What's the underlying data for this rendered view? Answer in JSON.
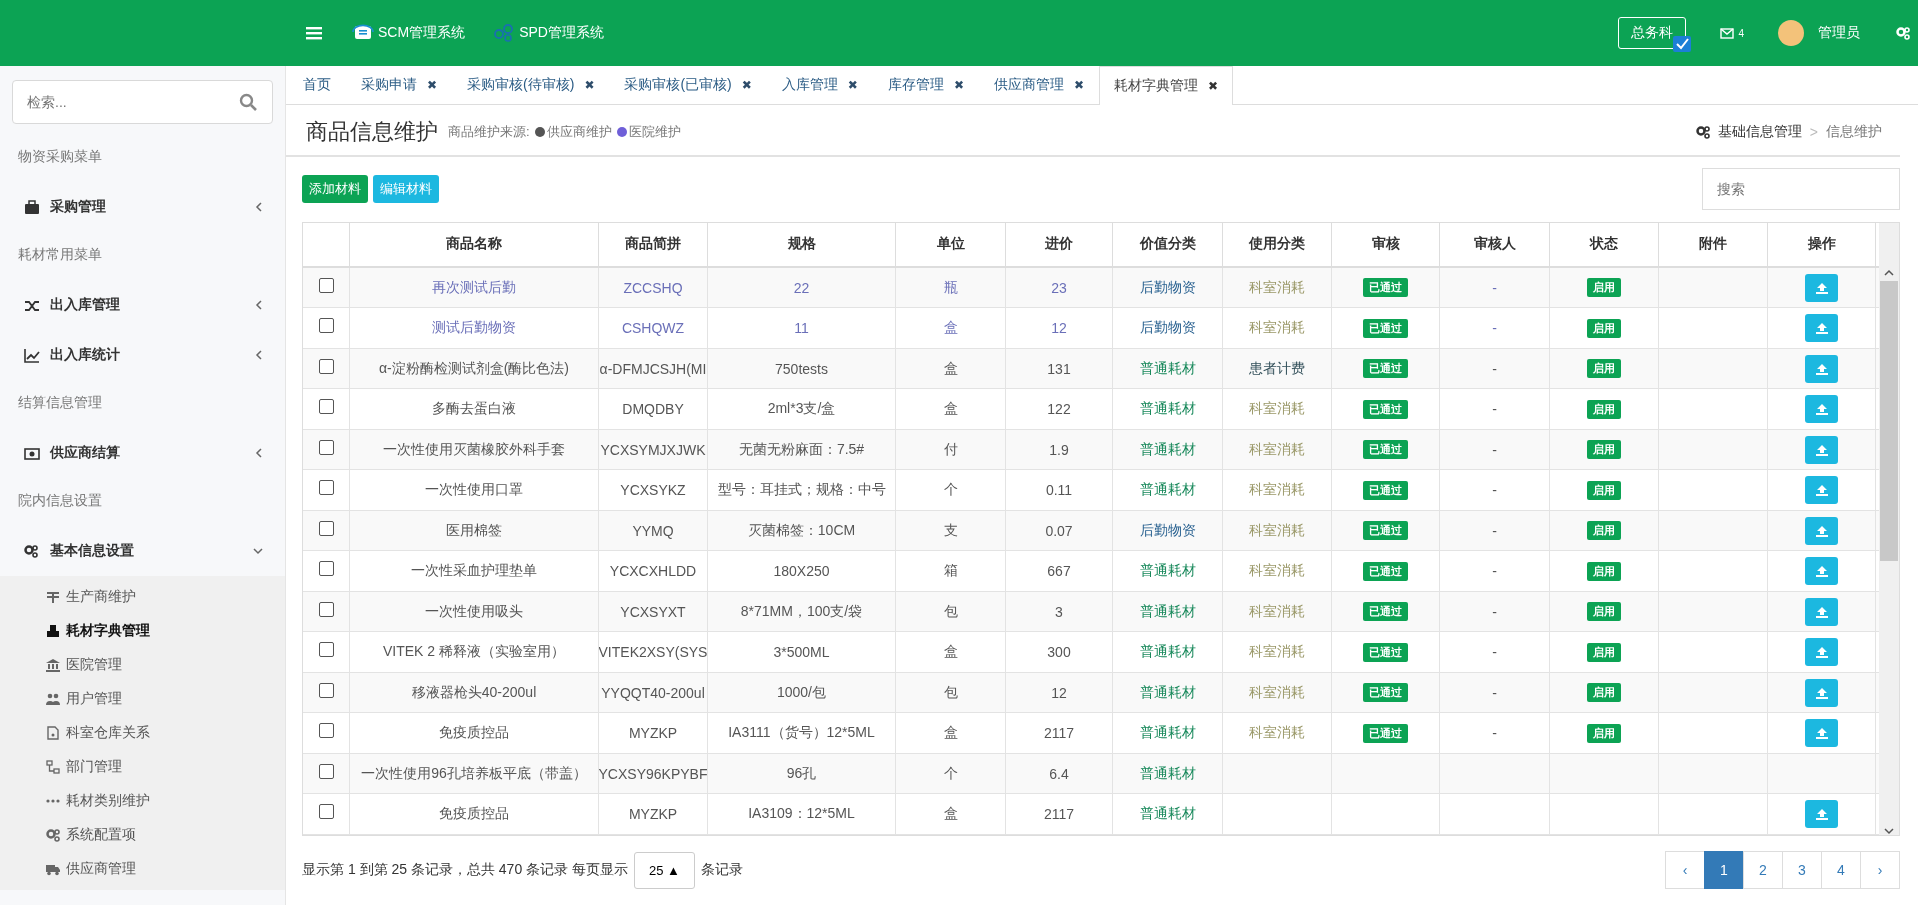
{
  "header": {
    "systems": [
      "SCM管理系统",
      "SPD管理系统"
    ],
    "department": "总务科",
    "mail_count": "4",
    "user": "管理员"
  },
  "sidebar": {
    "search": {
      "placeholder": "检索..."
    },
    "sections": [
      {
        "heading": "物资采购菜单",
        "items": [
          {
            "label": "采购管理",
            "expanded": false
          }
        ]
      },
      {
        "heading": "耗材常用菜单",
        "items": [
          {
            "label": "出入库管理",
            "expanded": false
          },
          {
            "label": "出入库统计",
            "expanded": false
          }
        ]
      },
      {
        "heading": "结算信息管理",
        "items": [
          {
            "label": "供应商结算",
            "expanded": false
          }
        ]
      },
      {
        "heading": "院内信息设置",
        "items": [
          {
            "label": "基本信息设置",
            "expanded": true,
            "children": [
              {
                "label": "生产商维护",
                "selected": false
              },
              {
                "label": "耗材字典管理",
                "selected": true
              },
              {
                "label": "医院管理",
                "selected": false
              },
              {
                "label": "用户管理",
                "selected": false
              },
              {
                "label": "科室仓库关系",
                "selected": false
              },
              {
                "label": "部门管理",
                "selected": false
              },
              {
                "label": "耗材类别维护",
                "selected": false
              },
              {
                "label": "系统配置项",
                "selected": false
              },
              {
                "label": "供应商管理",
                "selected": false
              }
            ]
          }
        ]
      }
    ]
  },
  "tabs": [
    {
      "label": "首页",
      "closable": false,
      "selected": false
    },
    {
      "label": "采购申请",
      "closable": true,
      "selected": false
    },
    {
      "label": "采购审核(待审核)",
      "closable": true,
      "selected": false
    },
    {
      "label": "采购审核(已审核)",
      "closable": true,
      "selected": false
    },
    {
      "label": "入库管理",
      "closable": true,
      "selected": false
    },
    {
      "label": "库存管理",
      "closable": true,
      "selected": false
    },
    {
      "label": "供应商管理",
      "closable": true,
      "selected": false
    },
    {
      "label": "耗材字典管理",
      "closable": true,
      "selected": true
    }
  ],
  "close_glyph": "✖",
  "page": {
    "title": "商品信息维护",
    "source_label": "商品维护来源:",
    "sources": [
      {
        "label": "供应商维护",
        "color": "#555555"
      },
      {
        "label": "医院维护",
        "color": "#6f5fd8"
      }
    ],
    "breadcrumb": [
      "基础信息管理",
      ">",
      "信息维护"
    ]
  },
  "toolbar": {
    "buttons": [
      {
        "label": "添加材料",
        "kind": "add"
      },
      {
        "label": "编辑材料",
        "kind": "edit"
      }
    ],
    "search": {
      "placeholder": "搜索"
    }
  },
  "table": {
    "columns": [
      "商品名称",
      "商品简拼",
      "规格",
      "单位",
      "进价",
      "价值分类",
      "使用分类",
      "审核",
      "审核人",
      "状态",
      "附件",
      "操作"
    ],
    "rows": [
      {
        "checked": false,
        "highlight": true,
        "name": "再次测试后勤",
        "pinyin": "ZCCSHQ",
        "spec": "22",
        "unit": "瓶",
        "price": "23",
        "value_class": {
          "text": "后勤物资",
          "kind": "logistics"
        },
        "usage": {
          "text": "科室消耗",
          "kind": "dept"
        },
        "audit": "已通过",
        "auditor": "-",
        "status": "启用",
        "action": true
      },
      {
        "checked": false,
        "highlight": true,
        "name": "测试后勤物资",
        "pinyin": "CSHQWZ",
        "spec": "11",
        "unit": "盒",
        "price": "12",
        "value_class": {
          "text": "后勤物资",
          "kind": "logistics"
        },
        "usage": {
          "text": "科室消耗",
          "kind": "dept"
        },
        "audit": "已通过",
        "auditor": "-",
        "status": "启用",
        "action": true
      },
      {
        "checked": false,
        "highlight": false,
        "name": "α-淀粉酶检测试剂盒(酶比色法)",
        "pinyin": "α-DFMJCSJH(MI",
        "spec": "750tests",
        "unit": "盒",
        "price": "131",
        "value_class": {
          "text": "普通耗材",
          "kind": "general"
        },
        "usage": {
          "text": "患者计费",
          "kind": "patient"
        },
        "audit": "已通过",
        "auditor": "-",
        "status": "启用",
        "action": true
      },
      {
        "checked": false,
        "highlight": false,
        "name": "多酶去蛋白液",
        "pinyin": "DMQDBY",
        "spec": "2ml*3支/盒",
        "unit": "盒",
        "price": "122",
        "value_class": {
          "text": "普通耗材",
          "kind": "general"
        },
        "usage": {
          "text": "科室消耗",
          "kind": "dept"
        },
        "audit": "已通过",
        "auditor": "-",
        "status": "启用",
        "action": true
      },
      {
        "checked": false,
        "highlight": false,
        "name": "一次性使用灭菌橡胶外科手套",
        "pinyin": "YCXSYMJXJWK",
        "spec": "无菌无粉麻面：7.5#",
        "unit": "付",
        "price": "1.9",
        "value_class": {
          "text": "普通耗材",
          "kind": "general"
        },
        "usage": {
          "text": "科室消耗",
          "kind": "dept"
        },
        "audit": "已通过",
        "auditor": "-",
        "status": "启用",
        "action": true
      },
      {
        "checked": false,
        "highlight": false,
        "name": "一次性使用口罩",
        "pinyin": "YCXSYKZ",
        "spec": "型号：耳挂式；规格：中号",
        "unit": "个",
        "price": "0.11",
        "value_class": {
          "text": "普通耗材",
          "kind": "general"
        },
        "usage": {
          "text": "科室消耗",
          "kind": "dept"
        },
        "audit": "已通过",
        "auditor": "-",
        "status": "启用",
        "action": true
      },
      {
        "checked": false,
        "highlight": false,
        "name": "医用棉签",
        "pinyin": "YYMQ",
        "spec": "灭菌棉签：10CM",
        "unit": "支",
        "price": "0.07",
        "value_class": {
          "text": "后勤物资",
          "kind": "logistics"
        },
        "usage": {
          "text": "科室消耗",
          "kind": "dept"
        },
        "audit": "已通过",
        "auditor": "-",
        "status": "启用",
        "action": true
      },
      {
        "checked": false,
        "highlight": false,
        "name": "一次性采血护理垫单",
        "pinyin": "YCXCXHLDD",
        "spec": "180X250",
        "unit": "箱",
        "price": "667",
        "value_class": {
          "text": "普通耗材",
          "kind": "general"
        },
        "usage": {
          "text": "科室消耗",
          "kind": "dept"
        },
        "audit": "已通过",
        "auditor": "-",
        "status": "启用",
        "action": true
      },
      {
        "checked": false,
        "highlight": false,
        "name": "一次性使用吸头",
        "pinyin": "YCXSYXT",
        "spec": "8*71MM，100支/袋",
        "unit": "包",
        "price": "3",
        "value_class": {
          "text": "普通耗材",
          "kind": "general"
        },
        "usage": {
          "text": "科室消耗",
          "kind": "dept"
        },
        "audit": "已通过",
        "auditor": "-",
        "status": "启用",
        "action": true
      },
      {
        "checked": false,
        "highlight": false,
        "name": "VITEK 2 稀释液（实验室用）",
        "pinyin": "VITEK2XSY(SYS",
        "spec": "3*500ML",
        "unit": "盒",
        "price": "300",
        "value_class": {
          "text": "普通耗材",
          "kind": "general"
        },
        "usage": {
          "text": "科室消耗",
          "kind": "dept"
        },
        "audit": "已通过",
        "auditor": "-",
        "status": "启用",
        "action": true
      },
      {
        "checked": false,
        "highlight": false,
        "name": "移液器枪头40-200ul",
        "pinyin": "YYQQT40-200ul",
        "spec": "1000/包",
        "unit": "包",
        "price": "12",
        "value_class": {
          "text": "普通耗材",
          "kind": "general"
        },
        "usage": {
          "text": "科室消耗",
          "kind": "dept"
        },
        "audit": "已通过",
        "auditor": "-",
        "status": "启用",
        "action": true
      },
      {
        "checked": false,
        "highlight": false,
        "name": "免疫质控品",
        "pinyin": "MYZKP",
        "spec": "IA3111（货号）12*5ML",
        "unit": "盒",
        "price": "2117",
        "value_class": {
          "text": "普通耗材",
          "kind": "general"
        },
        "usage": {
          "text": "科室消耗",
          "kind": "dept"
        },
        "audit": "已通过",
        "auditor": "-",
        "status": "启用",
        "action": true
      },
      {
        "checked": false,
        "highlight": false,
        "name": "一次性使用96孔培养板平底（带盖）",
        "pinyin": "YCXSY96KPYBF",
        "spec": "96孔",
        "unit": "个",
        "price": "6.4",
        "value_class": {
          "text": "普通耗材",
          "kind": "general"
        },
        "action": false
      },
      {
        "checked": false,
        "highlight": false,
        "name": "免疫质控品",
        "pinyin": "MYZKP",
        "spec": "IA3109：12*5ML",
        "unit": "盒",
        "price": "2117",
        "value_class": {
          "text": "普通耗材",
          "kind": "general"
        },
        "action": true
      }
    ]
  },
  "footer": {
    "summary": "显示第 1 到第 25 条记录，总共 470 条记录 每页显示",
    "page_size": "25 ▲",
    "suffix": "条记录",
    "pages": [
      {
        "label": "‹",
        "selected": false
      },
      {
        "label": "1",
        "selected": true
      },
      {
        "label": "2",
        "selected": false
      },
      {
        "label": "3",
        "selected": false
      },
      {
        "label": "4",
        "selected": false
      },
      {
        "label": "›",
        "selected": false
      }
    ]
  }
}
